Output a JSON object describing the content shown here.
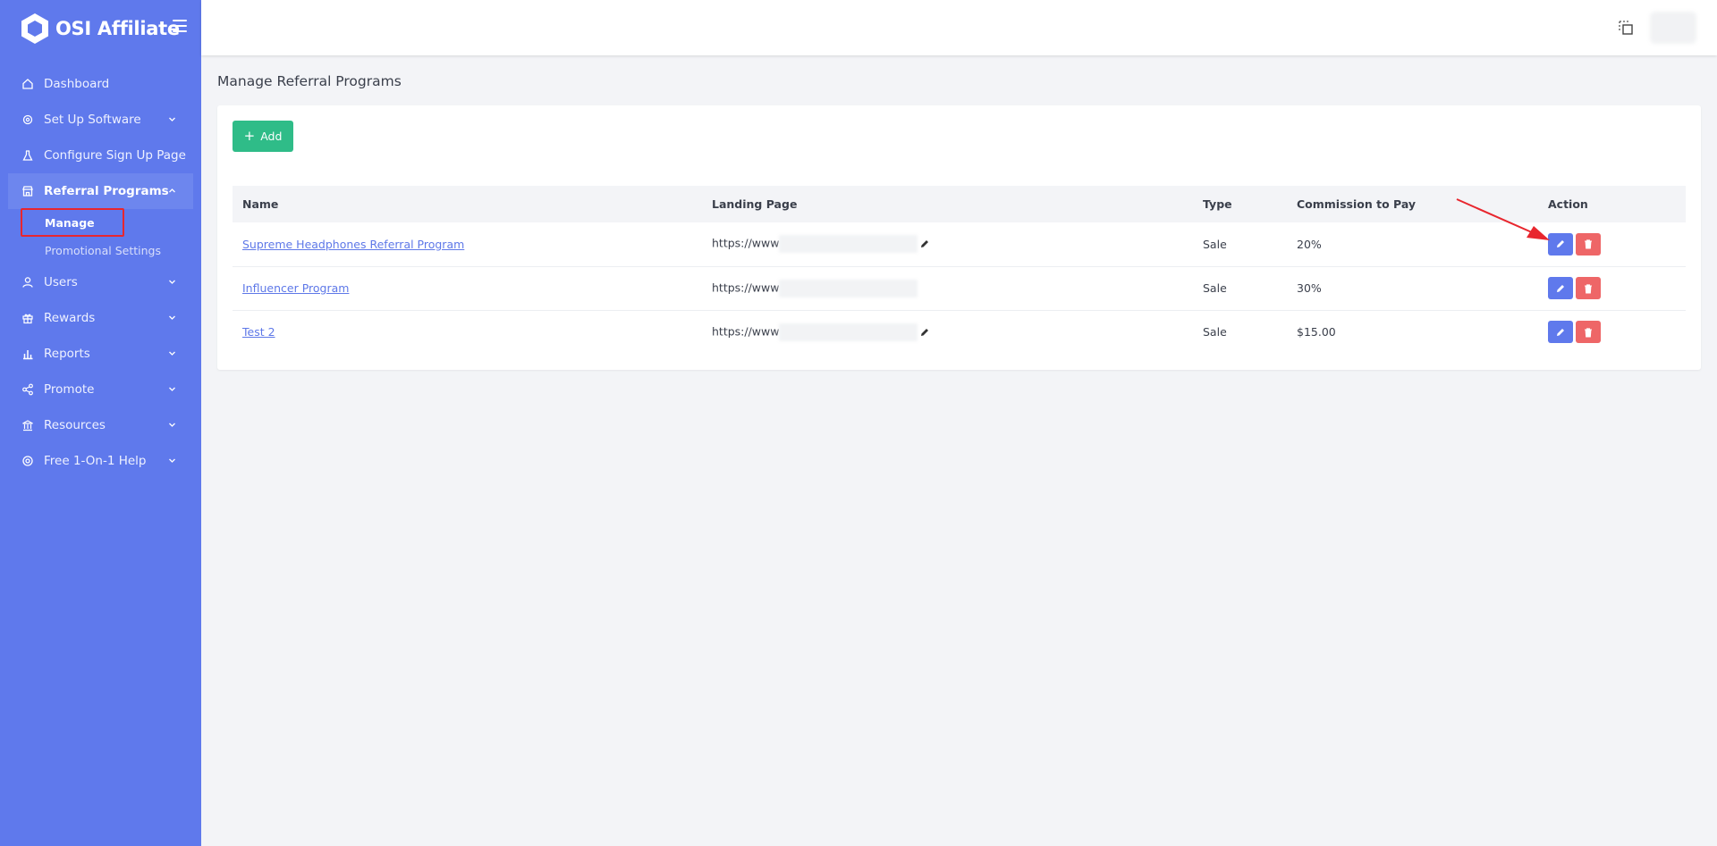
{
  "brand": {
    "name": "OSI Affiliate"
  },
  "sidebar": {
    "items": [
      {
        "label": "Dashboard",
        "icon": "home-icon"
      },
      {
        "label": "Set Up Software",
        "icon": "gear-icon",
        "expandable": true
      },
      {
        "label": "Configure Sign Up Page",
        "icon": "flask-icon"
      },
      {
        "label": "Referral Programs",
        "icon": "store-icon",
        "expanded": true,
        "sub": [
          {
            "label": "Manage",
            "current": true
          },
          {
            "label": "Promotional Settings"
          }
        ]
      },
      {
        "label": "Users",
        "icon": "user-icon",
        "expandable": true
      },
      {
        "label": "Rewards",
        "icon": "gift-icon",
        "expandable": true
      },
      {
        "label": "Reports",
        "icon": "bar-chart-icon",
        "expandable": true
      },
      {
        "label": "Promote",
        "icon": "share-icon",
        "expandable": true
      },
      {
        "label": "Resources",
        "icon": "bank-icon",
        "expandable": true
      },
      {
        "label": "Free 1-On-1 Help",
        "icon": "lifebuoy-icon",
        "expandable": true
      }
    ]
  },
  "page": {
    "title": "Manage Referral Programs"
  },
  "toolbar": {
    "add_label": "Add"
  },
  "table": {
    "columns": [
      "Name",
      "Landing Page",
      "Type",
      "Commission to Pay",
      "Action"
    ],
    "rows": [
      {
        "name": "Supreme Headphones Referral Program",
        "landing": "https://www",
        "type": "Sale",
        "commission": "20%"
      },
      {
        "name": "Influencer Program",
        "landing": "https://www",
        "type": "Sale",
        "commission": "30%"
      },
      {
        "name": "Test 2",
        "landing": "https://www",
        "type": "Sale",
        "commission": "$15.00"
      }
    ]
  },
  "colors": {
    "sidebar": "#5f79ec",
    "add_button": "#2fbc88",
    "edit_button": "#5f79ec",
    "delete_button": "#ee6667",
    "annotation": "#e8262e"
  }
}
